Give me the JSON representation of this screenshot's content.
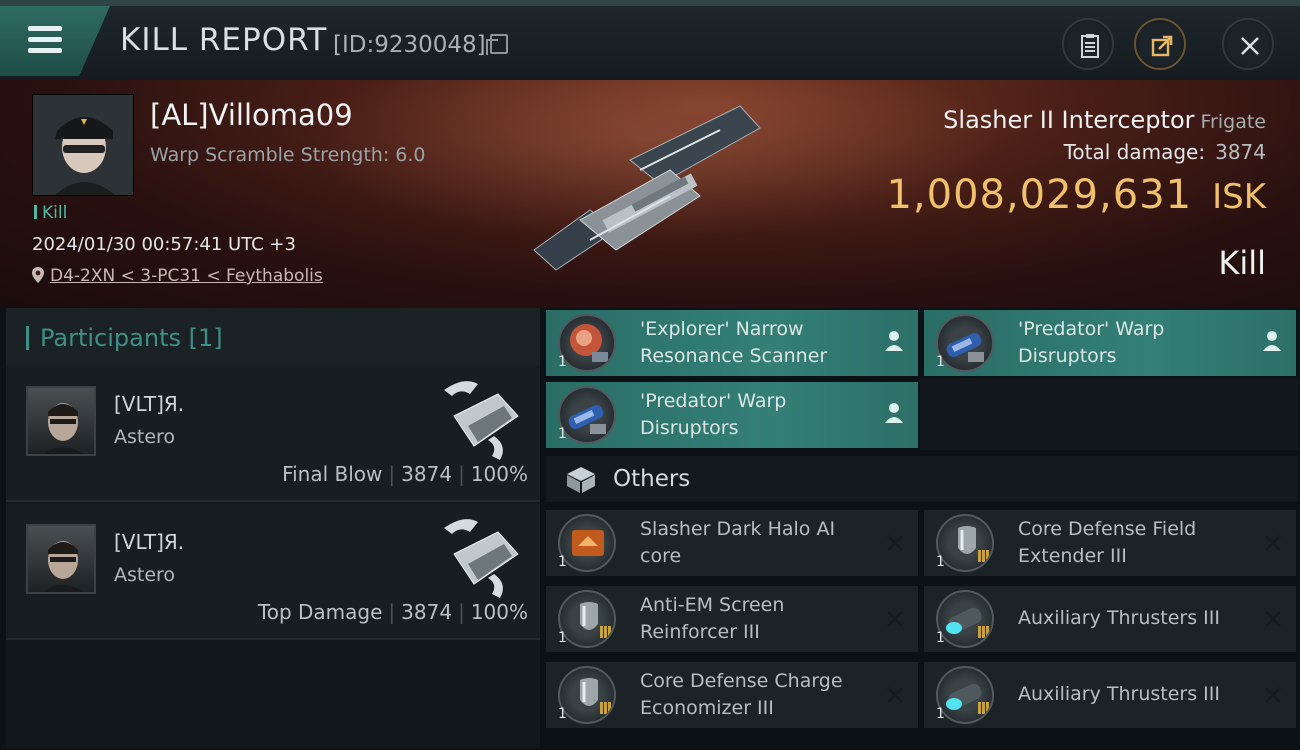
{
  "header": {
    "title": "KILL REPORT",
    "kill_id": "[ID:9230048]",
    "buttons": [
      "clipboard-icon",
      "share-icon",
      "close-icon"
    ]
  },
  "victim": {
    "name": "[AL]Villoma09",
    "warp_scramble": "Warp Scramble Strength: 6.0",
    "tag": "Kill",
    "timestamp": "2024/01/30 00:57:41 UTC +3",
    "location": "D4-2XN < 3-PC31 < Feythabolis",
    "ship_name": "Slasher II Interceptor",
    "ship_class": "Frigate",
    "total_damage_label": "Total damage:",
    "total_damage": "3874",
    "isk_value": "1,008,029,631",
    "isk_unit": "ISK",
    "status": "Kill"
  },
  "participants": {
    "title": "Participants [1]",
    "rows": [
      {
        "name": "[VLT]Я.",
        "ship": "Astero",
        "role": "Final Blow",
        "damage": "3874",
        "percent": "100%"
      },
      {
        "name": "[VLT]Я.",
        "ship": "Astero",
        "role": "Top Damage",
        "damage": "3874",
        "percent": "100%"
      }
    ]
  },
  "modules": {
    "fitted": [
      {
        "label": "'Explorer' Narrow Resonance Scanner",
        "qty": "1"
      },
      {
        "label": "'Predator' Warp Disruptors",
        "qty": "1"
      },
      {
        "label": "'Predator' Warp Disruptors",
        "qty": "1"
      }
    ],
    "others_title": "Others",
    "others": [
      {
        "label": "Slasher Dark Halo AI core",
        "qty": "1"
      },
      {
        "label": "Core Defense Field Extender III",
        "qty": "1"
      },
      {
        "label": "Anti-EM Screen Reinforcer III",
        "qty": "1"
      },
      {
        "label": "Auxiliary Thrusters III",
        "qty": "1"
      },
      {
        "label": "Core Defense Charge Economizer III",
        "qty": "1"
      },
      {
        "label": "Auxiliary Thrusters III",
        "qty": "1"
      }
    ]
  },
  "colors": {
    "accent_teal": "#347f76",
    "isk_gold": "#f0c06a",
    "kill_green": "#4db8a6"
  }
}
